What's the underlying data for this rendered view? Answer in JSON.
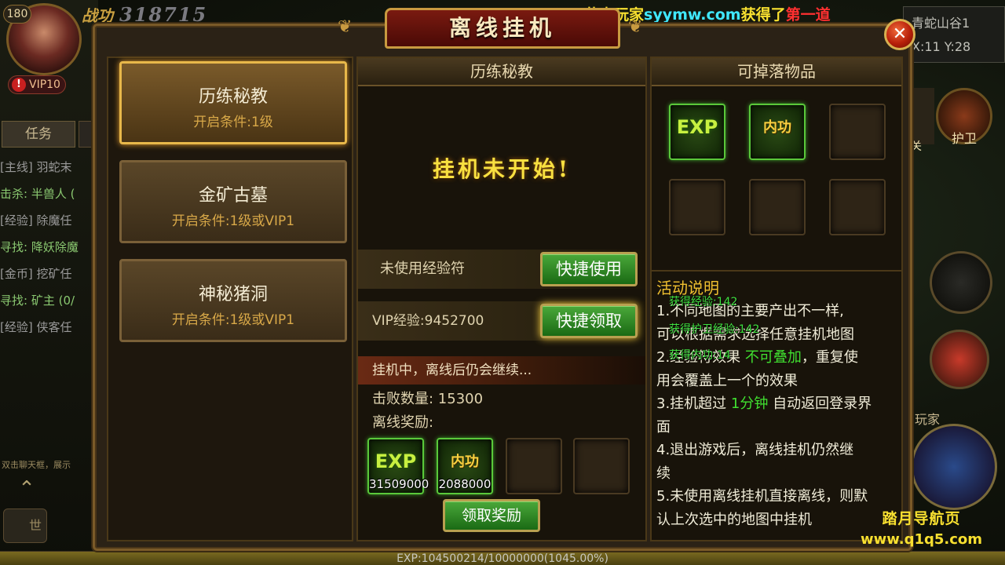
{
  "hud": {
    "level": "180",
    "vip": "VIP10",
    "combat_label": "战功",
    "combat_value": "318715",
    "task_tab": "任务",
    "quests": [
      {
        "text": "[主线] 羽蛇末",
        "color": "#9a9a9a"
      },
      {
        "text": "击杀: 半兽人 (",
        "color": "#8ac870"
      },
      {
        "text": "[经验] 除魔任",
        "color": "#9a9a9a"
      },
      {
        "text": "寻找: 降妖除魔",
        "color": "#8ac870"
      },
      {
        "text": "[金币] 挖矿任",
        "color": "#9a9a9a"
      },
      {
        "text": "寻找: 矿主 (0/",
        "color": "#8ac870"
      },
      {
        "text": "[经验] 侠客任",
        "color": "#9a9a9a"
      }
    ],
    "chat_hint": "双击聊天框，展示",
    "mic_label": "世",
    "map_name": "青蛇山谷1",
    "coords": "X:11 Y:28",
    "guard_label": "护卫",
    "side_label": "关",
    "player_label": "玩家",
    "exp_text": "EXP:104500214/10000000(1045.00%)",
    "exp_fraction": 1.0
  },
  "broadcast": {
    "part1": "恭喜玩家",
    "part2": "syymw.com",
    "part3": "获得了",
    "part4": "第一道",
    "colors": {
      "part1": "#f8e030",
      "part2": "#40e8ff",
      "part3": "#f8e030",
      "part4": "#ff3030"
    }
  },
  "panel": {
    "title": "离线挂机",
    "close_icon": "close-x",
    "maps": [
      {
        "name": "历练秘教",
        "condition": "开启条件:1级",
        "selected": true
      },
      {
        "name": "金矿古墓",
        "condition": "开启条件:1级或VIP1",
        "selected": false
      },
      {
        "name": "神秘猪洞",
        "condition": "开启条件:1级或VIP1",
        "selected": false
      }
    ],
    "middle": {
      "header": "历练秘教",
      "status": "挂机未开始!",
      "exp_scroll_label": "未使用经验符",
      "quick_use_button": "快捷使用",
      "vip_exp_label": "VIP经验:9452700",
      "quick_claim_button": "快捷领取",
      "progress_text": "挂机中，离线后仍会继续...",
      "kills_label": "击败数量: 15300",
      "rewards_label": "离线奖励:",
      "rewards": [
        {
          "icon": "EXP",
          "count": "31509000"
        },
        {
          "icon": "内功",
          "count": "2088000"
        }
      ],
      "claim_button": "领取奖励"
    },
    "right": {
      "header": "可掉落物品",
      "drops": [
        "EXP",
        "内功"
      ],
      "desc_title": "活动说明",
      "desc": [
        {
          "pre": "1.不同地图的主要产出不一样,",
          "hl": "",
          "post": ""
        },
        {
          "pre": "可以根据需求选择任意挂机地图",
          "hl": "",
          "post": ""
        },
        {
          "pre": "2.经验符效果 ",
          "hl": "不可叠加",
          "post": "，重复使"
        },
        {
          "pre": "用会覆盖上一个的效果",
          "hl": "",
          "post": ""
        },
        {
          "pre": "3.挂机超过 ",
          "hl": "1分钟",
          "post": " 自动返回登录界"
        },
        {
          "pre": "面",
          "hl": "",
          "post": ""
        },
        {
          "pre": "4.退出游戏后，离线挂机仍然继",
          "hl": "",
          "post": ""
        },
        {
          "pre": "续",
          "hl": "",
          "post": ""
        },
        {
          "pre": "5.未使用离线挂机直接离线，则默",
          "hl": "",
          "post": ""
        },
        {
          "pre": "认上次选中的地图中挂机",
          "hl": "",
          "post": ""
        }
      ],
      "float_msgs": [
        "获得经验:142",
        "获得护卫经验:142",
        "获得内功:14"
      ]
    }
  },
  "watermark": {
    "line1": "踏月导航页",
    "line2": "www.q1q5.com"
  }
}
